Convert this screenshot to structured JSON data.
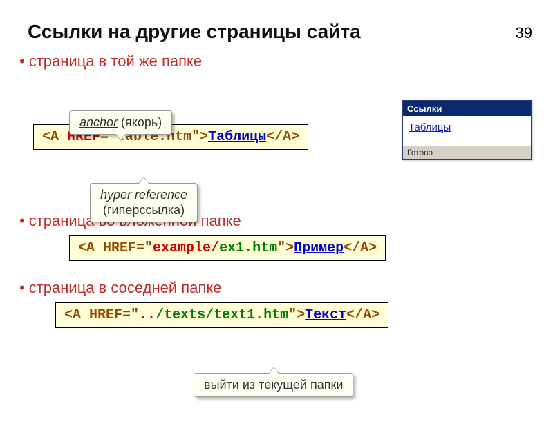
{
  "page_number": "39",
  "title": "Ссылки на другие страницы сайта",
  "b1": "страница в той же папке",
  "b2": "страница во вложенной папке",
  "b3": "страница в соседней папке",
  "tip1_underline": "anchor",
  "tip1_rest": " (якорь)",
  "tip2_underline": "hyper reference",
  "tip2_rest": "(гиперссылка)",
  "tip3": "выйти из текущей папки",
  "c1": {
    "open": "<A ",
    "attr": "HREF",
    "eq": "=",
    "val": "\"table.htm\"",
    "gt": ">",
    "link": "Таблицы",
    "close": "</A>"
  },
  "c2": {
    "open": "<A ",
    "attr": "HREF",
    "eq": "=\"",
    "dir": "example/",
    "file": "ex1.htm",
    "q": "\"",
    "gt": ">",
    "link": "Пример",
    "close": "</A>"
  },
  "c3": {
    "open": "<A ",
    "attr": "HREF",
    "eq": "=\"",
    "up": "..",
    "rest": "/texts/text1.htm",
    "q": "\"",
    "gt": ">",
    "link": "Текст",
    "close": "</A>"
  },
  "preview": {
    "title": "Ссылки",
    "link": "Таблицы",
    "status": "Готово"
  }
}
